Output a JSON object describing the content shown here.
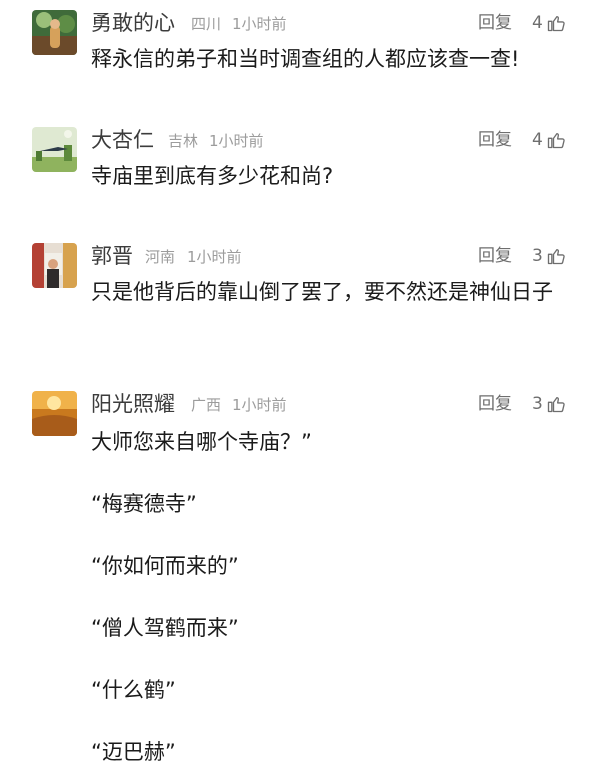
{
  "comments": [
    {
      "author": "勇敢的心",
      "location": "四川",
      "time": "1小时前",
      "reply_label": "回复",
      "likes": "4",
      "avatar_icon": "avatar-icon",
      "text": "释永信的弟子和当时调查组的人都应该查一查!"
    },
    {
      "author": "大杏仁",
      "location": "吉林",
      "time": "1小时前",
      "reply_label": "回复",
      "likes": "4",
      "avatar_icon": "avatar-icon",
      "text": "寺庙里到底有多少花和尚?"
    },
    {
      "author": "郭晋",
      "location": "河南",
      "time": "1小时前",
      "reply_label": "回复",
      "likes": "3",
      "avatar_icon": "avatar-icon",
      "text": "只是他背后的靠山倒了罢了，要不然还是神仙日子"
    },
    {
      "author": "阳光照耀",
      "location": "广西",
      "time": "1小时前",
      "reply_label": "回复",
      "likes": "3",
      "avatar_icon": "avatar-icon",
      "lines": [
        "大师您来自哪个寺庙？”",
        "“梅赛德寺”",
        "“你如何而来的”",
        "“僧人驾鹤而来”",
        "“什么鹤”",
        "“迈巴赫”"
      ]
    }
  ],
  "colors": {
    "text": "#1b1b1b",
    "name": "#3c3c3c",
    "meta": "#9c9c9c",
    "action": "#6e6e6e"
  },
  "icons": {
    "like": "thumbs-up-icon"
  }
}
